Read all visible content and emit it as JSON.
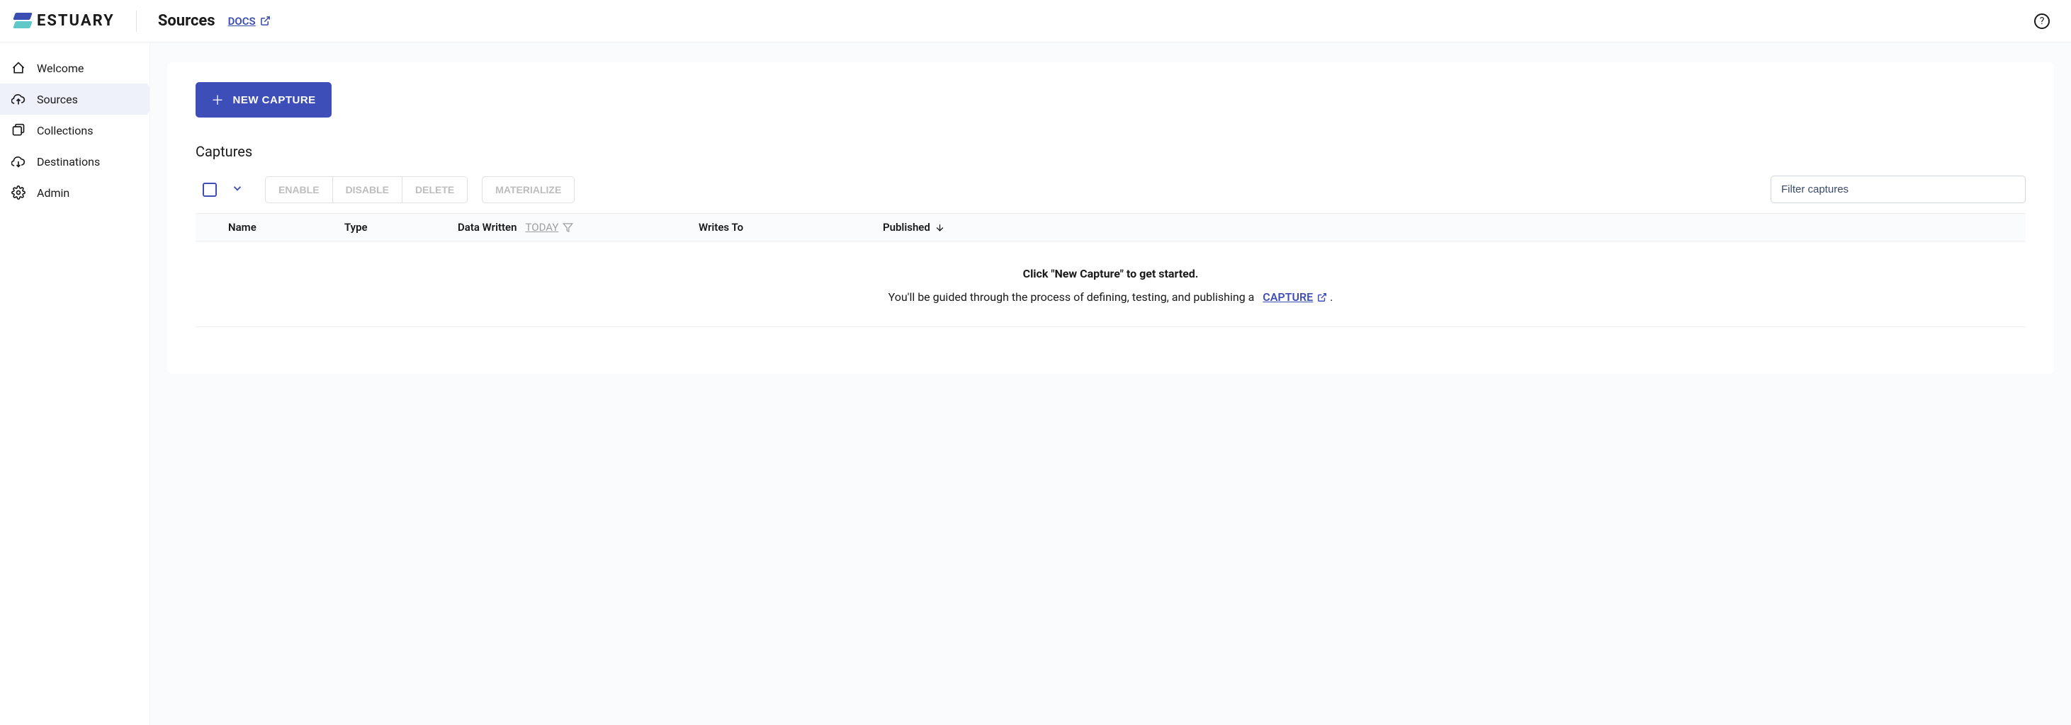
{
  "header": {
    "logo_text": "ESTUARY",
    "title": "Sources",
    "docs_label": "DOCS",
    "help_glyph": "?"
  },
  "sidebar": {
    "items": [
      {
        "label": "Welcome"
      },
      {
        "label": "Sources"
      },
      {
        "label": "Collections"
      },
      {
        "label": "Destinations"
      },
      {
        "label": "Admin"
      }
    ]
  },
  "main": {
    "new_capture_label": "NEW CAPTURE",
    "section_title": "Captures",
    "toolbar": {
      "enable": "ENABLE",
      "disable": "DISABLE",
      "delete": "DELETE",
      "materialize": "MATERIALIZE",
      "filter_placeholder": "Filter captures"
    },
    "columns": {
      "name": "Name",
      "type": "Type",
      "data_written": "Data Written",
      "today": "TODAY",
      "writes_to": "Writes To",
      "published": "Published"
    },
    "empty": {
      "title": "Click \"New Capture\" to get started.",
      "desc_prefix": "You'll be guided through the process of defining, testing, and publishing a",
      "capture_link": "CAPTURE",
      "desc_suffix": "."
    }
  }
}
